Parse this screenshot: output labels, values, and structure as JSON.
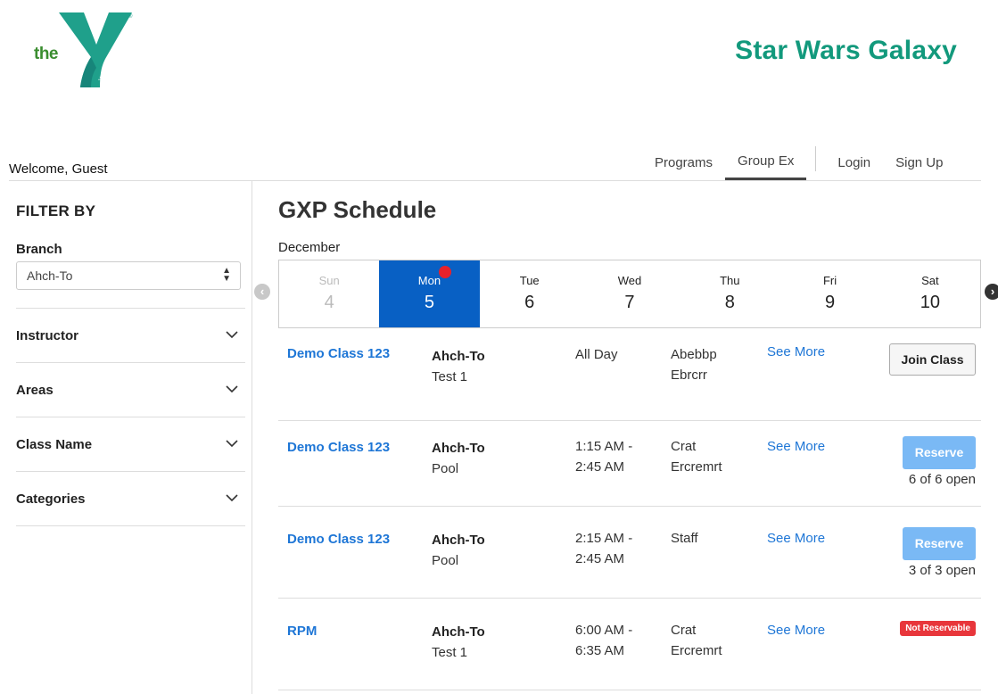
{
  "header": {
    "logo_text": "the",
    "logo_subtext": "YMCA",
    "site_title": "Star Wars Galaxy",
    "colors": {
      "title": "#12997c",
      "logo_y": "#1fa08b",
      "logo_the": "#3a8d2f"
    }
  },
  "topbar": {
    "welcome": "Welcome, Guest",
    "nav": [
      "Programs",
      "Group Ex",
      "Login",
      "Sign Up"
    ],
    "active_nav": "Group Ex"
  },
  "sidebar": {
    "title": "FILTER BY",
    "branch_label": "Branch",
    "branch_value": "Ahch-To",
    "filters": [
      "Instructor",
      "Areas",
      "Class Name",
      "Categories"
    ]
  },
  "schedule": {
    "title": "GXP Schedule",
    "month": "December",
    "days": [
      {
        "name": "Sun",
        "date": "4"
      },
      {
        "name": "Mon",
        "date": "5"
      },
      {
        "name": "Tue",
        "date": "6"
      },
      {
        "name": "Wed",
        "date": "7"
      },
      {
        "name": "Thu",
        "date": "8"
      },
      {
        "name": "Fri",
        "date": "9"
      },
      {
        "name": "Sat",
        "date": "10"
      }
    ],
    "selected_day": "Mon",
    "classes": [
      {
        "name": "Demo Class 123",
        "branch": "Ahch-To",
        "area": "Test 1",
        "time_1": "All Day",
        "time_2": "",
        "instructor_1": "Abebbp",
        "instructor_2": "Ebrcrr",
        "link": "See More",
        "action": "Join Class",
        "open": ""
      },
      {
        "name": "Demo Class 123",
        "branch": "Ahch-To",
        "area": "Pool",
        "time_1": "1:15 AM -",
        "time_2": "2:45 AM",
        "instructor_1": "Crat",
        "instructor_2": "Ercremrt",
        "link": "See More",
        "action": "Reserve",
        "open": "6 of 6 open"
      },
      {
        "name": "Demo Class 123",
        "branch": "Ahch-To",
        "area": "Pool",
        "time_1": "2:15 AM -",
        "time_2": "2:45 AM",
        "instructor_1": "Staff",
        "instructor_2": "",
        "link": "See More",
        "action": "Reserve",
        "open": "3 of 3 open"
      },
      {
        "name": "RPM",
        "branch": "Ahch-To",
        "area": "Test 1",
        "time_1": "6:00 AM -",
        "time_2": "6:35 AM",
        "instructor_1": "Crat",
        "instructor_2": "Ercremrt",
        "link": "See More",
        "action": "Not Reservable",
        "open": ""
      }
    ],
    "colors": {
      "selected_day": "#0860c4",
      "link": "#1e76d6",
      "reserve": "#7ab9f5",
      "not_reservable": "#e8363b",
      "today_dot": "#e8212b"
    }
  }
}
